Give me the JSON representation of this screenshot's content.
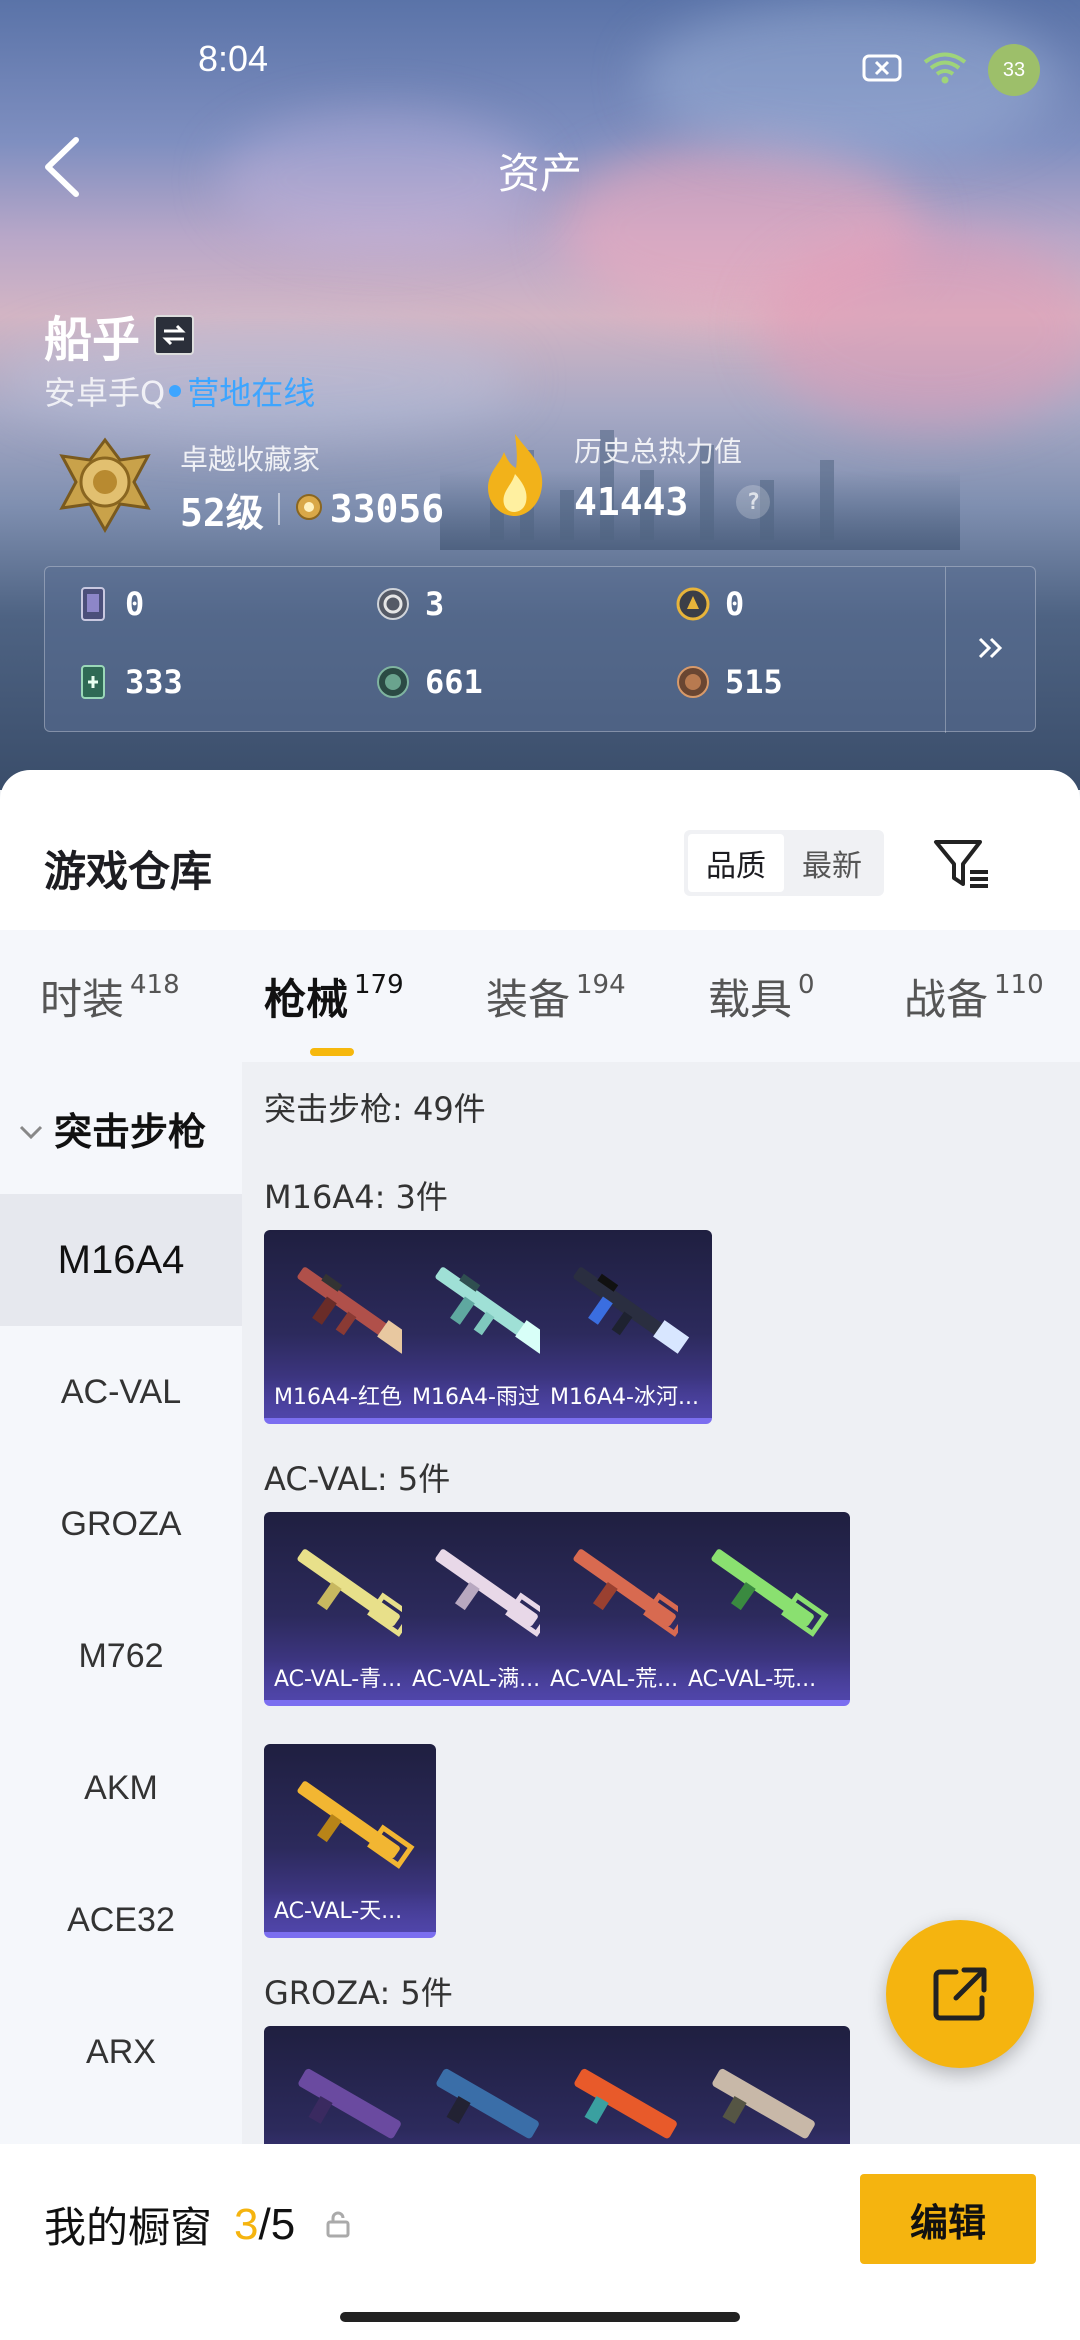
{
  "status": {
    "time": "8:04",
    "battery": "33"
  },
  "header": {
    "title": "资产"
  },
  "profile": {
    "name": "船乎",
    "platform": "安卓手Q",
    "online_status": "营地在线",
    "rank_label": "卓越收藏家",
    "level": "52级",
    "points": "33056",
    "heat_label": "历史总热力值",
    "heat_value": "41443",
    "help": "?"
  },
  "currencies": [
    {
      "icon": "card-icon",
      "value": "0"
    },
    {
      "icon": "silver-coin-icon",
      "value": "3"
    },
    {
      "icon": "gold-token-icon",
      "value": "0"
    },
    {
      "icon": "green-ticket-icon",
      "value": "333"
    },
    {
      "icon": "green-orb-icon",
      "value": "661"
    },
    {
      "icon": "bronze-coin-icon",
      "value": "515"
    }
  ],
  "warehouse": {
    "title": "游戏仓库",
    "sort_options": [
      "品质",
      "最新"
    ],
    "active_sort": "品质"
  },
  "tabs": [
    {
      "label": "时装",
      "count": "418"
    },
    {
      "label": "枪械",
      "count": "179",
      "active": true
    },
    {
      "label": "装备",
      "count": "194"
    },
    {
      "label": "载具",
      "count": "0"
    },
    {
      "label": "战备",
      "count": "110"
    }
  ],
  "sidebar": {
    "category": "突击步枪",
    "items": [
      "M16A4",
      "AC-VAL",
      "GROZA",
      "M762",
      "AKM",
      "ACE32",
      "ARX"
    ],
    "active": "M16A4"
  },
  "main": {
    "category_total": "突击步枪: 49件",
    "groups": [
      {
        "title": "M16A4: 3件",
        "items": [
          "M16A4-红色...",
          "M16A4-雨过...",
          "M16A4-冰河..."
        ]
      },
      {
        "title": "AC-VAL: 5件",
        "items": [
          "AC-VAL-青...",
          "AC-VAL-满...",
          "AC-VAL-荒...",
          "AC-VAL-玩...",
          "AC-VAL-天..."
        ]
      },
      {
        "title": "GROZA: 5件",
        "items": [
          "",
          "",
          "",
          ""
        ]
      }
    ]
  },
  "bottom": {
    "label": "我的橱窗",
    "current": "3",
    "total": "/5",
    "edit": "编辑"
  },
  "colors": {
    "accent": "#f5b40f",
    "online": "#3da5ff",
    "card_border": "#7b6ef0"
  }
}
